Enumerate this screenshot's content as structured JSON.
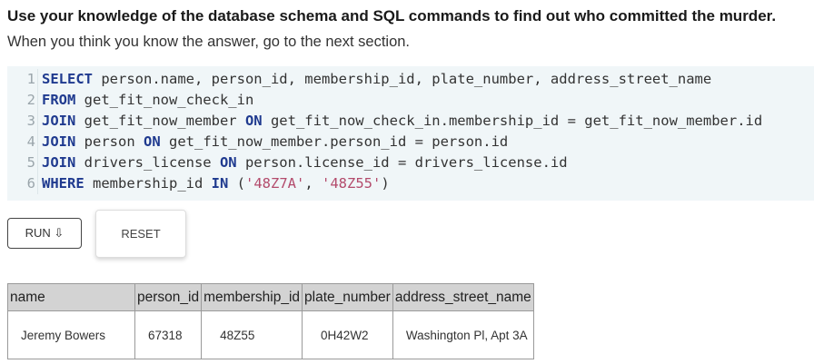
{
  "instructions": {
    "heading": "Use your knowledge of the database schema and SQL commands to find out who committed the murder.",
    "subtext": "When you think you know the answer, go to the next section."
  },
  "editor": {
    "lines": [
      {
        "number": "1",
        "tokens": [
          {
            "t": "SELECT",
            "k": "kw"
          },
          {
            "t": " person.name, person_id, membership_id, plate_number, address_street_name",
            "k": ""
          }
        ]
      },
      {
        "number": "2",
        "tokens": [
          {
            "t": "FROM",
            "k": "kw"
          },
          {
            "t": " get_fit_now_check_in",
            "k": ""
          }
        ]
      },
      {
        "number": "3",
        "tokens": [
          {
            "t": "JOIN",
            "k": "kw"
          },
          {
            "t": " get_fit_now_member ",
            "k": ""
          },
          {
            "t": "ON",
            "k": "kw"
          },
          {
            "t": " get_fit_now_check_in.membership_id = get_fit_now_member.id",
            "k": ""
          }
        ]
      },
      {
        "number": "4",
        "tokens": [
          {
            "t": "JOIN",
            "k": "kw"
          },
          {
            "t": " person ",
            "k": ""
          },
          {
            "t": "ON",
            "k": "kw"
          },
          {
            "t": " get_fit_now_member.person_id = person.id",
            "k": ""
          }
        ]
      },
      {
        "number": "5",
        "tokens": [
          {
            "t": "JOIN",
            "k": "kw"
          },
          {
            "t": " drivers_license ",
            "k": ""
          },
          {
            "t": "ON",
            "k": "kw"
          },
          {
            "t": " person.license_id = drivers_license.id",
            "k": ""
          }
        ]
      },
      {
        "number": "6",
        "tokens": [
          {
            "t": "WHERE",
            "k": "kw"
          },
          {
            "t": " membership_id ",
            "k": ""
          },
          {
            "t": "IN",
            "k": "kw"
          },
          {
            "t": " (",
            "k": ""
          },
          {
            "t": "'48Z7A'",
            "k": "str"
          },
          {
            "t": ", ",
            "k": ""
          },
          {
            "t": "'48Z55'",
            "k": "str"
          },
          {
            "t": ")",
            "k": ""
          }
        ]
      }
    ]
  },
  "buttons": {
    "run_label": "RUN ⇩",
    "reset_label": "RESET"
  },
  "results": {
    "columns": [
      "name",
      "person_id",
      "membership_id",
      "plate_number",
      "address_street_name"
    ],
    "rows": [
      [
        "Jeremy Bowers",
        "67318",
        "48Z55",
        "0H42W2",
        "Washington Pl, Apt 3A"
      ]
    ]
  },
  "colors": {
    "keyword": "#1f3a8f",
    "string": "#b34b6c",
    "editor_bg": "#f0f6f8",
    "header_bg": "#d3d3d3"
  }
}
